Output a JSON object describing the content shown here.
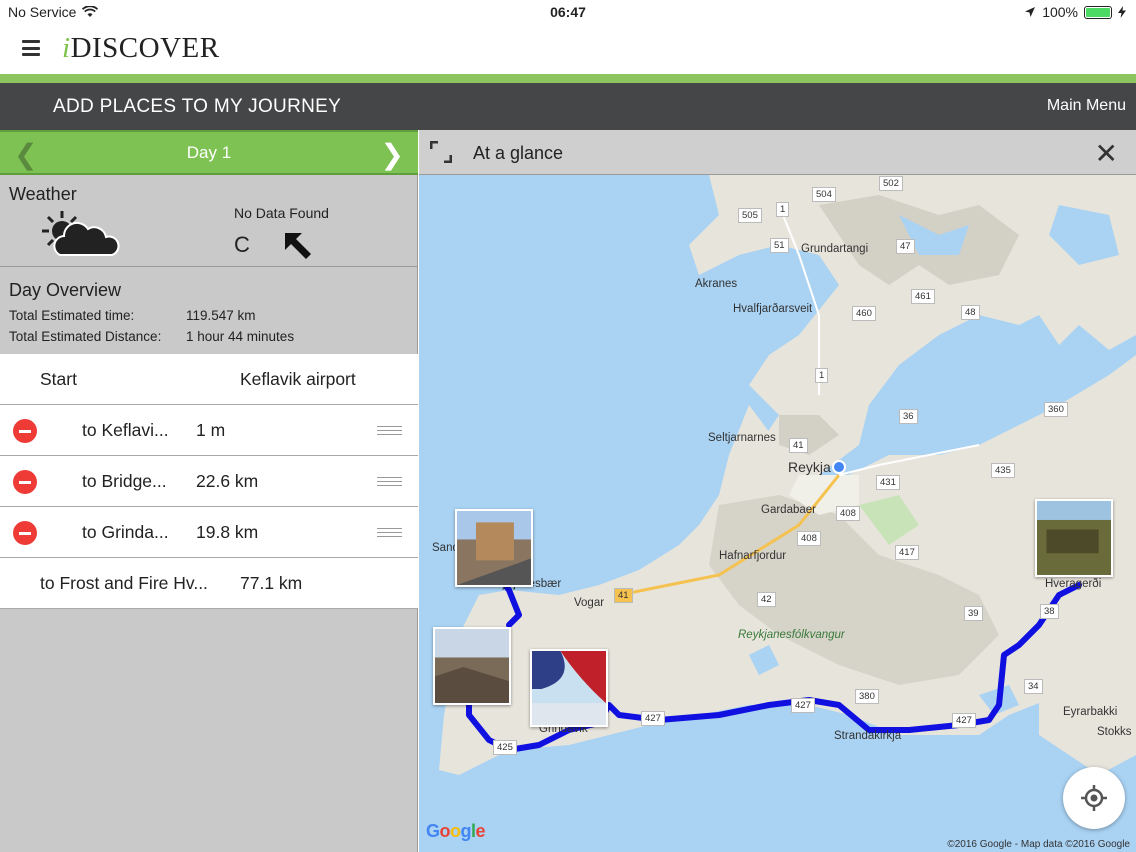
{
  "status_bar": {
    "carrier": "No Service",
    "time": "06:47",
    "battery": "100%",
    "battery_level": 1.0
  },
  "app": {
    "logo_i": "i",
    "logo_rest": "DISCOVER"
  },
  "top_bar": {
    "title": "ADD PLACES TO MY JOURNEY",
    "main_menu": "Main Menu"
  },
  "day_nav": {
    "label": "Day 1"
  },
  "weather": {
    "label": "Weather",
    "no_data": "No Data Found",
    "unit": "C"
  },
  "overview": {
    "title": "Day Overview",
    "time_label": "Total Estimated time:",
    "time_value": "119.547 km",
    "distance_label": "Total Estimated Distance:",
    "distance_value": "1 hour 44 minutes"
  },
  "journey": {
    "start_label": "Start",
    "start_place": "Keflavik airport",
    "legs": [
      {
        "dest": "to Keflavi...",
        "dist": "1 m"
      },
      {
        "dest": "to Bridge...",
        "dist": "22.6 km"
      },
      {
        "dest": "to Grinda...",
        "dist": "19.8 km"
      }
    ],
    "final_leg": {
      "dest": "to Frost and Fire Hv...",
      "dist": "77.1 km"
    }
  },
  "map_header": {
    "title": "At a glance"
  },
  "map": {
    "place_labels": {
      "akranes": "Akranes",
      "grundartangi": "Grundartangi",
      "hvalfjardarsveit": "Hvalfjarðarsveit",
      "seltjarnarnes": "Seltjarnarnes",
      "reykja": "Reykja",
      "gardabaer": "Gardabaer",
      "hafnarfjordur": "Hafnarfjordur",
      "vogar": "Vogar",
      "reykjanesfolkvangur": "Reykjanesfólkvangur",
      "strandakirkja": "Strandakirkja",
      "eyrarbakki": "Eyrarbakki",
      "stokks": "Stokks",
      "sand": "Sand",
      "hveragerdi": "Hveragerði",
      "reykjanesbaer": "Reykjanesbær",
      "grindavik": "Grindavik"
    },
    "road_numbers": {
      "r504": "504",
      "r502": "502",
      "r505": "505",
      "r1a": "1",
      "r51": "51",
      "r47": "47",
      "r461": "461",
      "r460": "460",
      "r48": "48",
      "r1b": "1",
      "r36": "36",
      "r360": "360",
      "r41a": "41",
      "r435": "435",
      "r431": "431",
      "r408a": "408",
      "r408b": "408",
      "r417": "417",
      "r41b": "41",
      "r42": "42",
      "r39": "39",
      "r38": "38",
      "r34": "34",
      "r380": "380",
      "r427a": "427",
      "r427b": "427",
      "r427c": "427",
      "r425": "425"
    },
    "google": "Google",
    "copyright": "©2016 Google - Map data ©2016 Google",
    "route_color": "#1010e0"
  },
  "icons": {
    "menu": "hamburger-icon",
    "weather": "partly-cloudy-icon",
    "wind": "wind-direction-arrow-icon",
    "expand": "expand-icon",
    "close": "close-icon",
    "locate": "my-location-icon"
  }
}
